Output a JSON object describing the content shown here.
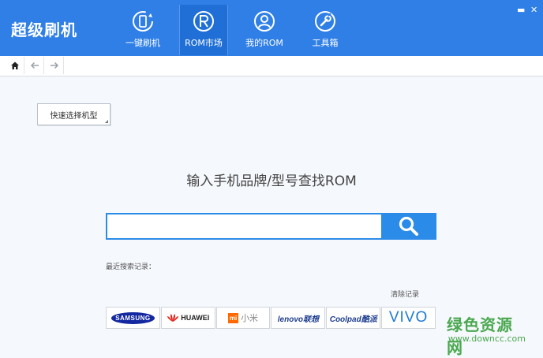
{
  "app": {
    "title": "超级刷机"
  },
  "tabs": [
    {
      "label": "一键刷机",
      "icon": "phone-refresh-icon"
    },
    {
      "label": "ROM市场",
      "icon": "rom-market-icon"
    },
    {
      "label": "我的ROM",
      "icon": "user-icon"
    },
    {
      "label": "工具箱",
      "icon": "wrench-icon"
    }
  ],
  "window_controls": {
    "minimize": "▬",
    "close": "✕"
  },
  "toolbar": {
    "home_icon": "home-icon",
    "back_icon": "arrow-left-icon",
    "forward_icon": "arrow-right-icon"
  },
  "quick_select": {
    "label": "快速选择机型"
  },
  "search": {
    "heading": "输入手机品牌/型号查找ROM",
    "placeholder": "",
    "value": ""
  },
  "recent": {
    "label": "最近搜索记录：",
    "clear_label": "清除记录"
  },
  "brands": [
    {
      "name": "SAMSUNG",
      "color": "#1428a0"
    },
    {
      "name": "HUAWEI",
      "color": "#e2231a"
    },
    {
      "name": "小米",
      "color": "#ff6900"
    },
    {
      "name": "lenovo联想",
      "color": "#e2231a"
    },
    {
      "name": "Coolpad酷派",
      "color": "#1d3d8f"
    },
    {
      "name": "VIVO",
      "color": "#1b7ad4"
    }
  ],
  "watermark": {
    "text": "绿色资源网",
    "url": "www.downcc.com"
  },
  "colors": {
    "header": "#2f7fe6",
    "accent": "#2b8be8"
  }
}
